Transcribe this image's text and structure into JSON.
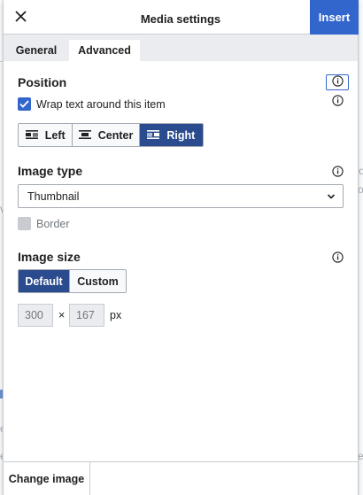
{
  "dialog": {
    "title": "Media settings",
    "insert_label": "Insert"
  },
  "tabs": [
    {
      "label": "General",
      "active": false
    },
    {
      "label": "Advanced",
      "active": true
    }
  ],
  "position": {
    "title": "Position",
    "wrap_label": "Wrap text around this item",
    "wrap_checked": true,
    "alignments": [
      {
        "label": "Left",
        "icon": "align-left-icon",
        "active": false
      },
      {
        "label": "Center",
        "icon": "align-center-icon",
        "active": false
      },
      {
        "label": "Right",
        "icon": "align-right-icon",
        "active": true
      }
    ]
  },
  "image_type": {
    "title": "Image type",
    "selected": "Thumbnail",
    "border_label": "Border",
    "border_checked": false
  },
  "image_size": {
    "title": "Image size",
    "options": [
      {
        "label": "Default",
        "active": true
      },
      {
        "label": "Custom",
        "active": false
      }
    ],
    "width": "300",
    "height": "167",
    "separator": "×",
    "unit": "px"
  },
  "footer": {
    "change_image_label": "Change image"
  },
  "background": {
    "fragments": [
      "o",
      "on",
      "v",
      "e",
      "e",
      "e"
    ]
  },
  "colors": {
    "accent": "#3366cc",
    "active_segment": "#2a4b8d",
    "border": "#a2a9b1"
  }
}
